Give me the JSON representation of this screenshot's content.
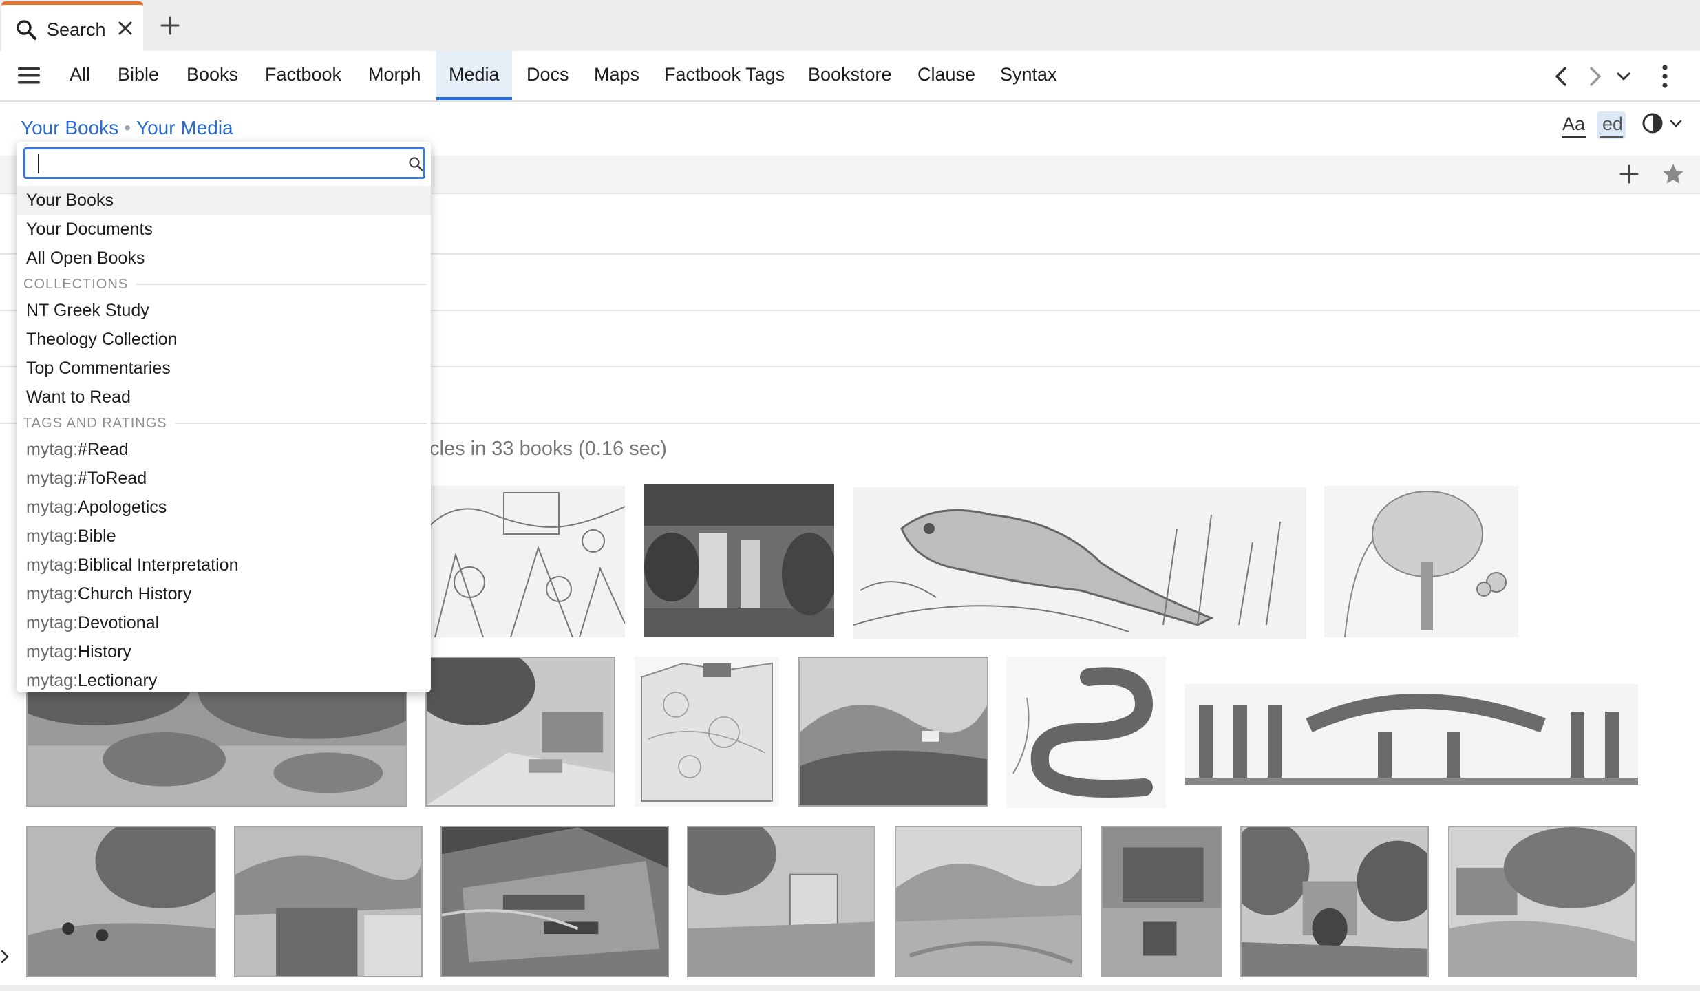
{
  "tab": {
    "label": "Search"
  },
  "nav": {
    "items": [
      "All",
      "Bible",
      "Books",
      "Factbook",
      "Morph",
      "Media",
      "Docs",
      "Maps",
      "Factbook Tags",
      "Bookstore",
      "Clause",
      "Syntax"
    ],
    "active": "Media"
  },
  "breadcrumb": {
    "first": "Your Books",
    "separator": "•",
    "second": "Your Media"
  },
  "toolbar": {
    "font_label": "Aa",
    "ed_label": "ed"
  },
  "results": {
    "count_text": "cles in 33 books (0.16 sec)"
  },
  "dropdown": {
    "search_value": "",
    "top_items": [
      "Your Books",
      "Your Documents",
      "All Open Books"
    ],
    "collections_label": "COLLECTIONS",
    "collections": [
      "NT Greek Study",
      "Theology Collection",
      "Top Commentaries",
      "Want to Read"
    ],
    "tags_label": "TAGS AND RATINGS",
    "tag_prefix": "mytag:",
    "tags": [
      "#Read",
      "#ToRead",
      "Apologetics",
      "Bible",
      "Biblical Interpretation",
      "Church History",
      "Devotional",
      "History",
      "Lectionary"
    ]
  },
  "colors": {
    "accent": "#2a6dd0",
    "tab_accent": "#e8702a",
    "link": "#2b6cd2"
  },
  "icons": [
    "search-icon",
    "close-icon",
    "plus-icon",
    "hamburger-icon",
    "chevron-left-icon",
    "chevron-right-icon",
    "chevron-down-icon",
    "more-vertical-icon",
    "contrast-icon",
    "star-icon"
  ]
}
